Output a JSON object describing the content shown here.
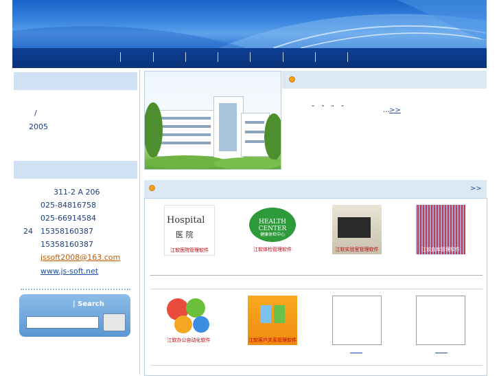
{
  "sidebar": {
    "company_slash": "/",
    "company_year": "2005",
    "address": "311-2 A 206",
    "phone1": "025-84816758",
    "phone2": "025-66914584",
    "hours_label": "24",
    "mobile1": "15358160387",
    "mobile2": "15358160387",
    "email": "jssoft2008@163.com",
    "website": "www.js-soft.net",
    "search_label": "| Search",
    "search_value": ""
  },
  "intro": {
    "snippet": "“    ”    “    ”",
    "more_prefix": "…",
    "more_link": ">>"
  },
  "products": {
    "more_link": ">>",
    "items": [
      {
        "title_en": "Hospital",
        "title_cn": "医 院",
        "caption": "江软医院管理软件"
      },
      {
        "title_en": "HEALTH CENTER",
        "title_cn": "健康体检中心",
        "caption": "江软体检管理软件"
      },
      {
        "caption": "江软实验室管理软件"
      },
      {
        "caption": "江软血库管理软件"
      },
      {
        "caption": "江软办公自动化软件"
      },
      {
        "caption": "江软客户关系管理软件"
      }
    ]
  },
  "colors": {
    "nav": "#0c3f94",
    "header_bg": "#cfe1f3",
    "bullet": "#f7a21b",
    "link": "#1b4fa8"
  }
}
